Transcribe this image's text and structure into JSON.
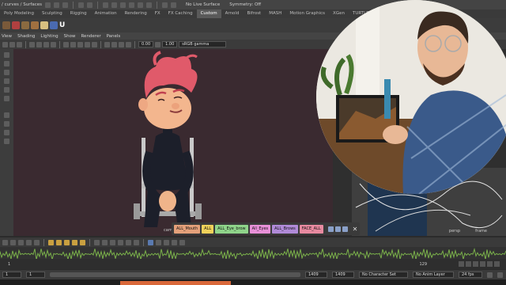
{
  "status_line": {
    "left_text": "/ curves / Surfaces",
    "live_surface": "No Live Surface",
    "symmetry": "Symmetry: Off"
  },
  "shelf_tabs": [
    "Poly Modeling",
    "Sculpting",
    "Rigging",
    "Animation",
    "Rendering",
    "FX",
    "FX Caching",
    "Custom",
    "Arnold",
    "Bifrost",
    "MASH",
    "Motion Graphics",
    "XGen",
    "TURTLE"
  ],
  "active_shelf_tab": "Custom",
  "view_menu": [
    "View",
    "Shading",
    "Lighting",
    "Show",
    "Renderer",
    "Panels"
  ],
  "view_tools": {
    "field_a": "0.00",
    "field_b": "1.00",
    "colorspace": "sRGB gamma"
  },
  "viewport": {
    "camera_label": "cam"
  },
  "side_panel": {
    "persp_label": "persp",
    "frame_label": "frame"
  },
  "selection_buttons": [
    {
      "label": "ALL_Mouth",
      "color": "#e4a07a"
    },
    {
      "label": "ALL",
      "color": "#f0d15a"
    },
    {
      "label": "ALL_Eye_brow",
      "color": "#8fd48a"
    },
    {
      "label": "All_Eyes",
      "color": "#e890d8"
    },
    {
      "label": "ALL_Brows",
      "color": "#b08ad8"
    },
    {
      "label": "FACE_ALL",
      "color": "#e88aa0"
    }
  ],
  "timeline": {
    "start_frame": "1",
    "current_frame": "1",
    "range_start": "1",
    "range_end": "1409",
    "range_end_2": "1409",
    "end_frame": "129",
    "character_set": "No Character Set",
    "anim_layer": "No Anim Layer",
    "fps": "24 fps"
  },
  "colors": {
    "viewport_bg": "#3a2a30",
    "accent_orange": "#d9683a",
    "hair": "#e05a6a"
  }
}
